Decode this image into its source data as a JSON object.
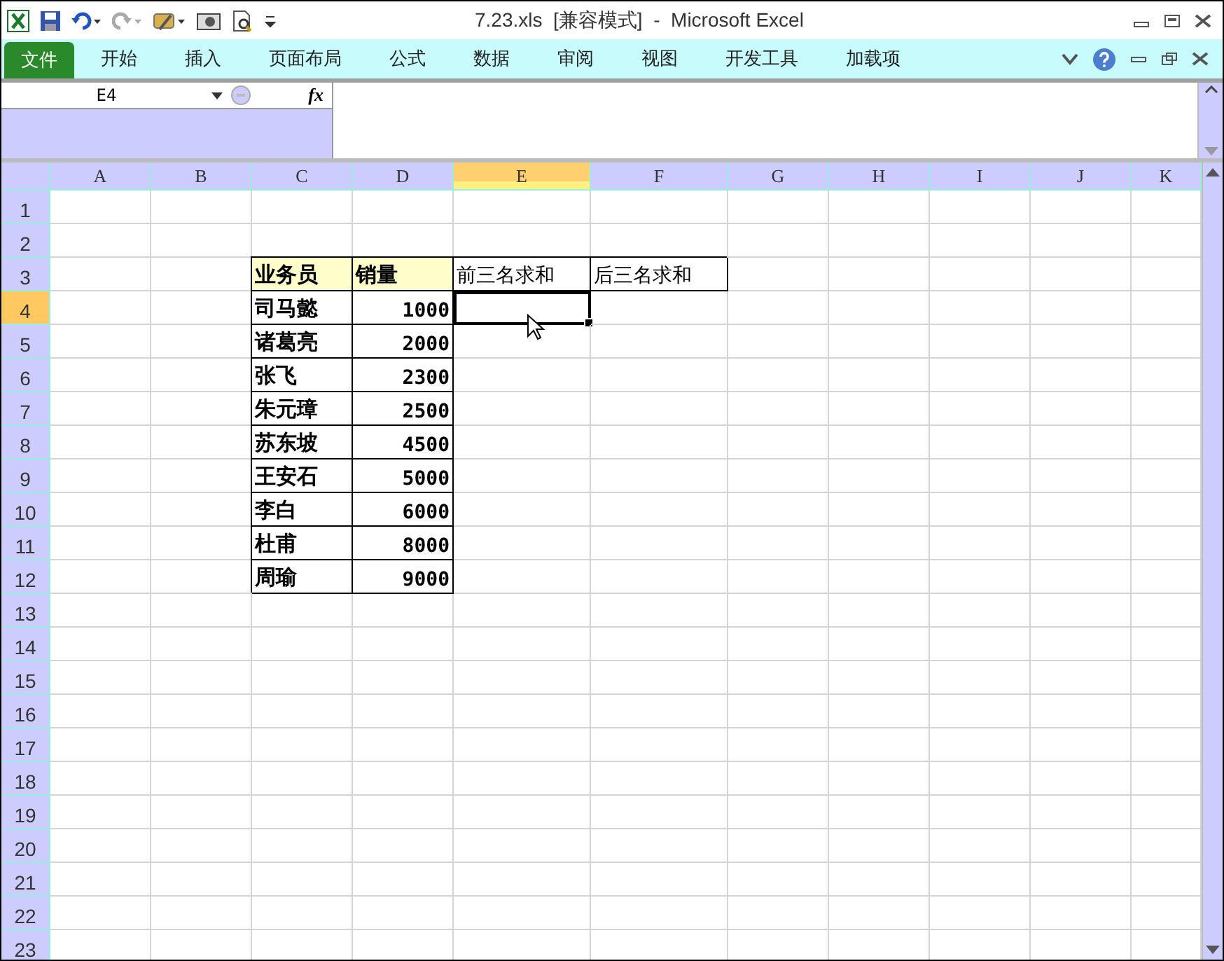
{
  "window": {
    "title": "7.23.xls  [兼容模式]  -  Microsoft Excel"
  },
  "tabs": [
    {
      "label": "文件",
      "kind": "file"
    },
    {
      "label": "开始",
      "kind": "tab"
    },
    {
      "label": "插入",
      "kind": "tab"
    },
    {
      "label": "页面布局",
      "kind": "tab"
    },
    {
      "label": "公式",
      "kind": "tab"
    },
    {
      "label": "数据",
      "kind": "tab"
    },
    {
      "label": "审阅",
      "kind": "tab"
    },
    {
      "label": "视图",
      "kind": "tab"
    },
    {
      "label": "开发工具",
      "kind": "tab"
    },
    {
      "label": "加载项",
      "kind": "tab"
    }
  ],
  "formula_bar": {
    "name_box": "E4",
    "fx": "fx"
  },
  "sheet": {
    "columns": [
      {
        "label": "A",
        "selected": false
      },
      {
        "label": "B",
        "selected": false
      },
      {
        "label": "C",
        "selected": false
      },
      {
        "label": "D",
        "selected": false
      },
      {
        "label": "E",
        "selected": true
      },
      {
        "label": "F",
        "selected": false
      },
      {
        "label": "G",
        "selected": false
      },
      {
        "label": "H",
        "selected": false
      },
      {
        "label": "I",
        "selected": false
      },
      {
        "label": "J",
        "selected": false
      },
      {
        "label": "K",
        "selected": false
      }
    ],
    "rows": [
      {
        "label": "1",
        "selected": false,
        "cells": []
      },
      {
        "label": "2",
        "selected": false,
        "cells": []
      },
      {
        "label": "3",
        "selected": false,
        "cells": [
          {
            "text": "",
            "kind": "blank"
          },
          {
            "text": "",
            "kind": "blank"
          },
          {
            "text": "业务员",
            "kind": "header"
          },
          {
            "text": "销量",
            "kind": "header"
          },
          {
            "text": "前三名求和",
            "kind": "label"
          },
          {
            "text": "后三名求和",
            "kind": "label"
          }
        ]
      },
      {
        "label": "4",
        "selected": true,
        "cells": [
          {
            "text": "",
            "kind": "blank"
          },
          {
            "text": "",
            "kind": "blank"
          },
          {
            "text": "司马懿",
            "kind": "name"
          },
          {
            "text": "1000",
            "kind": "number"
          }
        ]
      },
      {
        "label": "5",
        "selected": false,
        "cells": [
          {
            "text": "",
            "kind": "blank"
          },
          {
            "text": "",
            "kind": "blank"
          },
          {
            "text": "诸葛亮",
            "kind": "name"
          },
          {
            "text": "2000",
            "kind": "number"
          }
        ]
      },
      {
        "label": "6",
        "selected": false,
        "cells": [
          {
            "text": "",
            "kind": "blank"
          },
          {
            "text": "",
            "kind": "blank"
          },
          {
            "text": "张飞",
            "kind": "name"
          },
          {
            "text": "2300",
            "kind": "number"
          }
        ]
      },
      {
        "label": "7",
        "selected": false,
        "cells": [
          {
            "text": "",
            "kind": "blank"
          },
          {
            "text": "",
            "kind": "blank"
          },
          {
            "text": "朱元璋",
            "kind": "name"
          },
          {
            "text": "2500",
            "kind": "number"
          }
        ]
      },
      {
        "label": "8",
        "selected": false,
        "cells": [
          {
            "text": "",
            "kind": "blank"
          },
          {
            "text": "",
            "kind": "blank"
          },
          {
            "text": "苏东坡",
            "kind": "name"
          },
          {
            "text": "4500",
            "kind": "number"
          }
        ]
      },
      {
        "label": "9",
        "selected": false,
        "cells": [
          {
            "text": "",
            "kind": "blank"
          },
          {
            "text": "",
            "kind": "blank"
          },
          {
            "text": "王安石",
            "kind": "name"
          },
          {
            "text": "5000",
            "kind": "number"
          }
        ]
      },
      {
        "label": "10",
        "selected": false,
        "cells": [
          {
            "text": "",
            "kind": "blank"
          },
          {
            "text": "",
            "kind": "blank"
          },
          {
            "text": "李白",
            "kind": "name"
          },
          {
            "text": "6000",
            "kind": "number"
          }
        ]
      },
      {
        "label": "11",
        "selected": false,
        "cells": [
          {
            "text": "",
            "kind": "blank"
          },
          {
            "text": "",
            "kind": "blank"
          },
          {
            "text": "杜甫",
            "kind": "name"
          },
          {
            "text": "8000",
            "kind": "number"
          }
        ]
      },
      {
        "label": "12",
        "selected": false,
        "cells": [
          {
            "text": "",
            "kind": "blank"
          },
          {
            "text": "",
            "kind": "blank"
          },
          {
            "text": "周瑜",
            "kind": "name"
          },
          {
            "text": "9000",
            "kind": "number"
          }
        ]
      },
      {
        "label": "13",
        "selected": false,
        "cells": []
      },
      {
        "label": "14",
        "selected": false,
        "cells": []
      },
      {
        "label": "15",
        "selected": false,
        "cells": []
      },
      {
        "label": "16",
        "selected": false,
        "cells": []
      },
      {
        "label": "17",
        "selected": false,
        "cells": []
      },
      {
        "label": "18",
        "selected": false,
        "cells": []
      },
      {
        "label": "19",
        "selected": false,
        "cells": []
      },
      {
        "label": "20",
        "selected": false,
        "cells": []
      },
      {
        "label": "21",
        "selected": false,
        "cells": []
      },
      {
        "label": "22",
        "selected": false,
        "cells": []
      },
      {
        "label": "23",
        "selected": false,
        "cells": []
      }
    ]
  }
}
